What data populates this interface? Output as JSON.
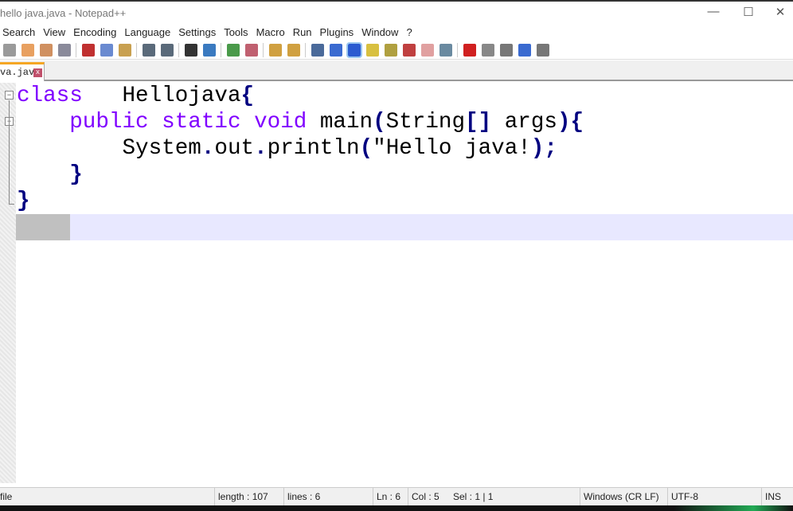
{
  "window": {
    "title": "hello java.java - Notepad++",
    "minimize": "—",
    "maximize": "☐",
    "close": "✕"
  },
  "menu": [
    "Search",
    "View",
    "Encoding",
    "Language",
    "Settings",
    "Tools",
    "Macro",
    "Run",
    "Plugins",
    "Window",
    "?"
  ],
  "toolbar_icons": [
    "close-all",
    "close",
    "close-others",
    "print",
    "cut",
    "copy",
    "paste",
    "undo",
    "redo",
    "find",
    "replace",
    "zoom-in",
    "zoom-out",
    "sync-vertical",
    "sync-horizontal",
    "word-wrap",
    "show-all-chars",
    "indent-guide",
    "user-defined-language",
    "doc-map",
    "function-list",
    "folder-as-workspace",
    "monitor",
    "record-macro",
    "stop-recording",
    "play-macro",
    "run-macro-multiple",
    "save-macro"
  ],
  "tab": {
    "label": "va.java",
    "close": "x"
  },
  "code": {
    "l1": {
      "kw": "class",
      "rest": "   Hellojava",
      "brace": "{"
    },
    "l2": {
      "indent": "    ",
      "kw": "public static void",
      "name": " main",
      "p1": "(",
      "arg": "String",
      "br": "[]",
      "arg2": " args",
      "p2": ")",
      "brace": "{"
    },
    "l3": {
      "indent": "        ",
      "a": "System",
      "d1": ".",
      "b": "out",
      "d2": ".",
      "c": "println",
      "p1": "(",
      "s": "\"Hello java!",
      "p2": ")",
      "semi": ";"
    },
    "l4": {
      "indent": "    ",
      "brace": "}"
    },
    "l5": {
      "brace": "}"
    }
  },
  "status": {
    "type": "file",
    "length": "length : 107",
    "lines": "lines : 6",
    "ln": "Ln : 6",
    "col": "Col : 5",
    "sel": "Sel : 1 | 1",
    "eol": "Windows (CR LF)",
    "encoding": "UTF-8",
    "mode": "INS"
  }
}
